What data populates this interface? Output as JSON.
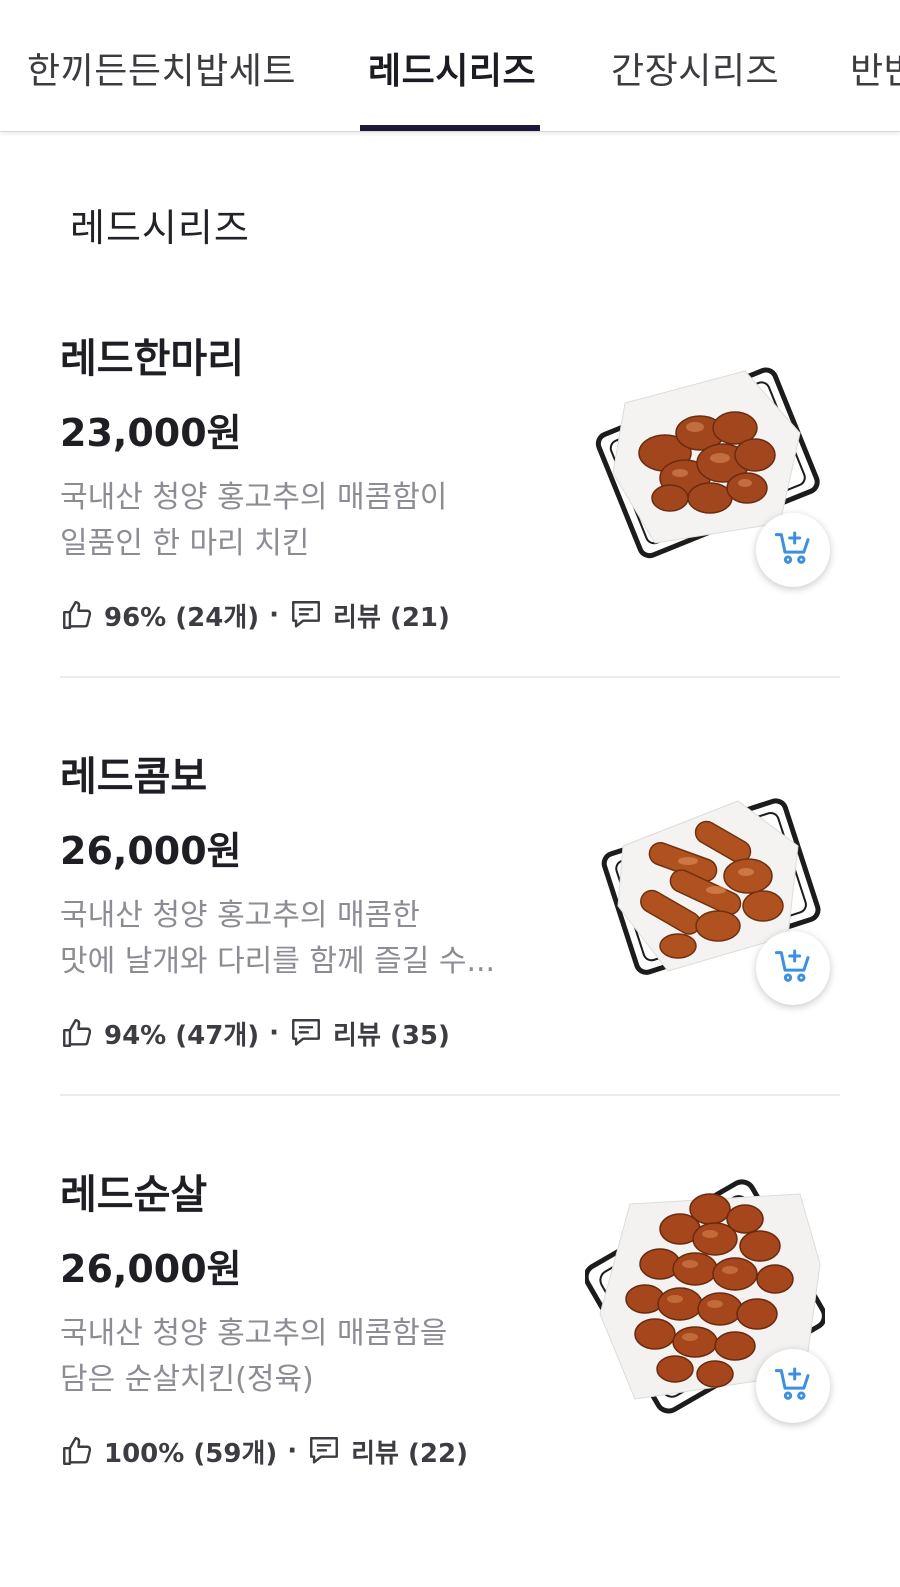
{
  "tabs": [
    {
      "label": "한끼든든치밥세트",
      "active": false
    },
    {
      "label": "레드시리즈",
      "active": true
    },
    {
      "label": "간장시리즈",
      "active": false
    },
    {
      "label": "반반",
      "active": false
    }
  ],
  "section": {
    "title": "레드시리즈"
  },
  "items": [
    {
      "name": "레드한마리",
      "price": "23,000원",
      "desc_line1": "국내산 청양 홍고추의 매콤함이",
      "desc_line2": "일품인 한 마리 치킨",
      "rating": "96% (24개)",
      "separator": "·",
      "reviews": "리뷰 (21)",
      "image_icon": "fried-chicken-basket",
      "cart_icon": "add-to-cart-icon"
    },
    {
      "name": "레드콤보",
      "price": "26,000원",
      "desc_line1": "국내산 청양 홍고추의 매콤한",
      "desc_line2": "맛에 날개와 다리를 함께 즐길 수...",
      "rating": "94% (47개)",
      "separator": "·",
      "reviews": "리뷰 (35)",
      "image_icon": "fried-chicken-combo-basket",
      "cart_icon": "add-to-cart-icon"
    },
    {
      "name": "레드순살",
      "price": "26,000원",
      "desc_line1": "국내산 청양 홍고추의 매콤함을",
      "desc_line2": "담은 순살치킨(정육)",
      "rating": "100% (59개)",
      "separator": "·",
      "reviews": "리뷰 (22)",
      "image_icon": "boneless-chicken-basket",
      "cart_icon": "add-to-cart-icon"
    }
  ],
  "colors": {
    "tab_underline": "#1b1a38",
    "text_primary": "#1e1e24",
    "text_secondary": "#8c8c95",
    "cart_icon": "#3d8fe0",
    "chicken": "#a9481f"
  }
}
